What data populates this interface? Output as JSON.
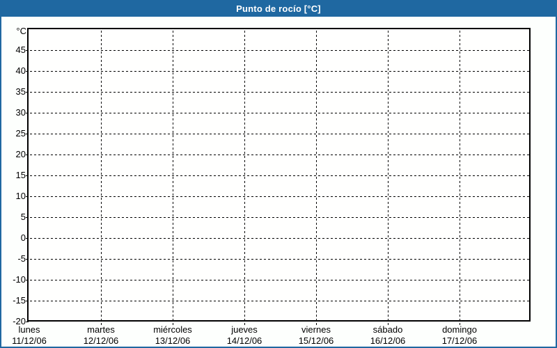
{
  "window": {
    "background": "#fdfffd",
    "border_color": "#1f68a1"
  },
  "title_bar": {
    "title": "Punto de rocío [°C]",
    "background": "#1f68a1",
    "text_color": "#ffffff"
  },
  "chart_data": {
    "type": "line",
    "title": "Punto de rocío [°C]",
    "series": [],
    "y_axis": {
      "unit": "°C",
      "min": -20,
      "max": 50,
      "tick_step": 5,
      "tick_labels": [
        "45",
        "40",
        "35",
        "30",
        "25",
        "20",
        "15",
        "10",
        "5",
        "0",
        "-5",
        "-10",
        "-15",
        "-20"
      ],
      "grid": "dashed"
    },
    "x_axis": {
      "categories": [
        {
          "day": "lunes",
          "date": "11/12/06"
        },
        {
          "day": "martes",
          "date": "12/12/06"
        },
        {
          "day": "miércoles",
          "date": "13/12/06"
        },
        {
          "day": "jueves",
          "date": "14/12/06"
        },
        {
          "day": "viernes",
          "date": "15/12/06"
        },
        {
          "day": "domingo",
          "date": "17/12/06"
        }
      ],
      "categories_full": [
        {
          "day": "lunes",
          "date": "11/12/06"
        },
        {
          "day": "martes",
          "date": "12/12/06"
        },
        {
          "day": "miércoles",
          "date": "13/12/06"
        },
        {
          "day": "jueves",
          "date": "14/12/06"
        },
        {
          "day": "viernes",
          "date": "15/12/06"
        },
        {
          "day": "sábado",
          "date": "16/12/06"
        },
        {
          "day": "domingo",
          "date": "17/12/06"
        }
      ],
      "grid": "dashed"
    },
    "plot_background": "#ffffff",
    "axis_color": "#000000",
    "legend": "none"
  }
}
